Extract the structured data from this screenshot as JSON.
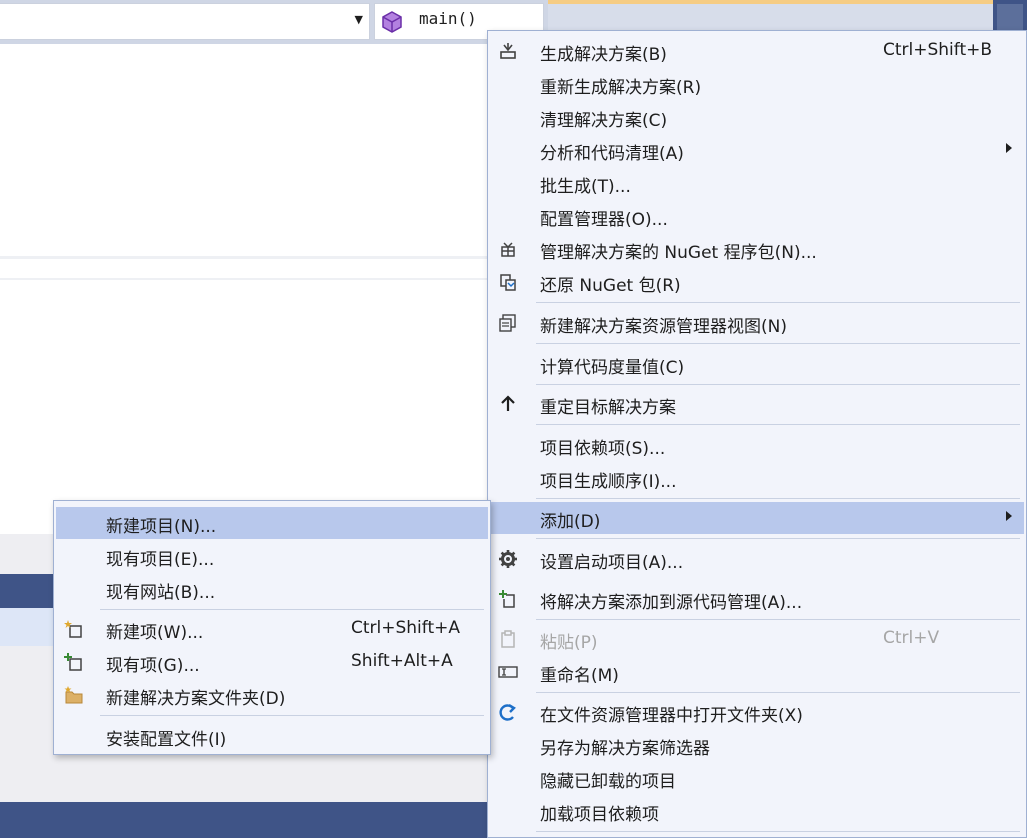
{
  "editor": {
    "function_combo_value": "main()"
  },
  "context_menu": {
    "items": [
      {
        "label": "生成解决方案(B)",
        "shortcut": "Ctrl+Shift+B",
        "icon": "build-icon"
      },
      {
        "label": "重新生成解决方案(R)"
      },
      {
        "label": "清理解决方案(C)"
      },
      {
        "label": "分析和代码清理(A)",
        "submenu": true
      },
      {
        "label": "批生成(T)..."
      },
      {
        "label": "配置管理器(O)..."
      },
      {
        "label": "管理解决方案的 NuGet 程序包(N)...",
        "icon": "nuget-package-icon"
      },
      {
        "label": "还原 NuGet 包(R)",
        "icon": "restore-icon"
      },
      {
        "label": "新建解决方案资源管理器视图(N)",
        "icon": "new-view-icon"
      },
      {
        "label": "计算代码度量值(C)"
      },
      {
        "label": "重定目标解决方案",
        "icon": "up-arrow-icon"
      },
      {
        "label": "项目依赖项(S)..."
      },
      {
        "label": "项目生成顺序(I)..."
      },
      {
        "label": "添加(D)",
        "submenu": true,
        "highlighted": true
      },
      {
        "label": "设置启动项目(A)...",
        "icon": "gear-icon"
      },
      {
        "label": "将解决方案添加到源代码管理(A)...",
        "icon": "source-control-add-icon"
      },
      {
        "label": "粘贴(P)",
        "shortcut": "Ctrl+V",
        "icon": "paste-icon",
        "disabled": true
      },
      {
        "label": "重命名(M)",
        "icon": "rename-icon"
      },
      {
        "label": "在文件资源管理器中打开文件夹(X)",
        "icon": "open-folder-icon"
      },
      {
        "label": "另存为解决方案筛选器"
      },
      {
        "label": "隐藏已卸载的项目"
      },
      {
        "label": "加载项目依赖项"
      }
    ]
  },
  "add_submenu": {
    "items": [
      {
        "label": "新建项目(N)...",
        "highlighted": true
      },
      {
        "label": "现有项目(E)..."
      },
      {
        "label": "现有网站(B)..."
      },
      {
        "label": "新建项(W)...",
        "shortcut": "Ctrl+Shift+A",
        "icon": "new-item-icon"
      },
      {
        "label": "现有项(G)...",
        "shortcut": "Shift+Alt+A",
        "icon": "existing-item-icon"
      },
      {
        "label": "新建解决方案文件夹(D)",
        "icon": "new-folder-icon"
      },
      {
        "label": "安装配置文件(I)"
      }
    ]
  },
  "colors": {
    "menu_background": "#f2f4fb",
    "highlight": "#b8c8ec",
    "panel_dark": "#3f5487",
    "toolbar_accent": "#f5cc84"
  }
}
